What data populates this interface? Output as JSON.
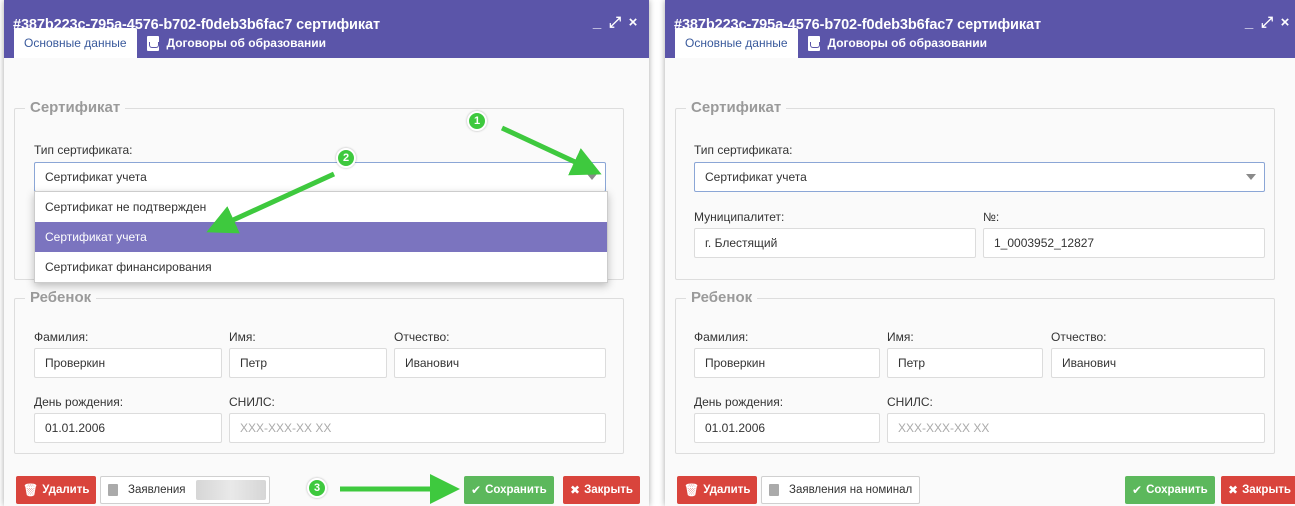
{
  "window": {
    "title": "#387b223c-795a-4576-b702-f0deb3b6fac7 сертификат",
    "controls": {
      "minimize": "_",
      "maximize": "⤢",
      "close": "×"
    }
  },
  "tabs": {
    "main": "Основные данные",
    "contracts": "Договоры об образовании"
  },
  "certificate": {
    "legend": "Сертификат",
    "type_label": "Тип сертификата:",
    "type_value": "Сертификат учета",
    "options": [
      "Сертификат не подтвержден",
      "Сертификат учета",
      "Сертификат финансирования"
    ],
    "municipality_label": "Муниципалитет:",
    "municipality_value": "г. Блестящий",
    "number_label": "№:",
    "number_value": "1_0003952_12827"
  },
  "child": {
    "legend": "Ребенок",
    "surname_label": "Фамилия:",
    "surname_value": "Проверкин",
    "name_label": "Имя:",
    "name_value": "Петр",
    "patronymic_label": "Отчество:",
    "patronymic_value": "Иванович",
    "birthday_label": "День рождения:",
    "birthday_value": "01.01.2006",
    "snils_label": "СНИЛС:",
    "snils_placeholder": "XXX-XXX-XX XX"
  },
  "footer": {
    "delete": "Удалить",
    "applications": "Заявления",
    "applications_full": "Заявления на номинал",
    "save": "Сохранить",
    "close": "Закрыть"
  },
  "annotations": {
    "step1": "1",
    "step2": "2",
    "step3": "3"
  },
  "colors": {
    "header": "#5b55a9",
    "selected_option": "#7b74bf",
    "save": "#5cb85c",
    "danger": "#d9443c",
    "arrow": "#3ec93e"
  }
}
